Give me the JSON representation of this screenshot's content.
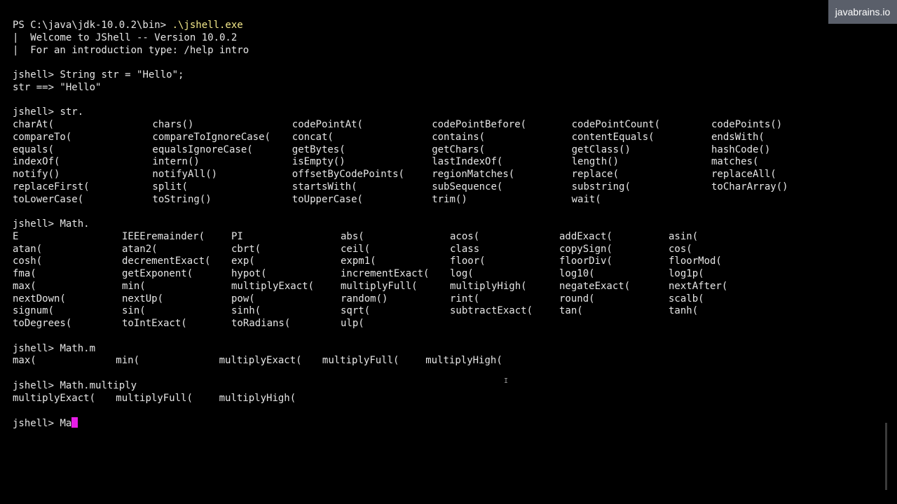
{
  "watermark": "javabrains.io",
  "session": {
    "ps_prompt": "PS C:\\java\\jdk-10.0.2\\bin> ",
    "ps_command": ".\\jshell.exe",
    "welcome_1": "|  Welcome to JShell -- Version 10.0.2",
    "welcome_2": "|  For an introduction type: /help intro",
    "prompt": "jshell> ",
    "cmd_string": "String str = \"Hello\";",
    "result_string": "str ==> \"Hello\"",
    "cmd_str_dot": "str.",
    "cmd_math_dot": "Math.",
    "cmd_math_m": "Math.m",
    "cmd_math_multiply": "Math.multiply",
    "cmd_current": "Ma"
  },
  "str_completions": [
    [
      "charAt(",
      "chars()",
      "codePointAt(",
      "codePointBefore(",
      "codePointCount(",
      "codePoints()"
    ],
    [
      "compareTo(",
      "compareToIgnoreCase(",
      "concat(",
      "contains(",
      "contentEquals(",
      "endsWith("
    ],
    [
      "equals(",
      "equalsIgnoreCase(",
      "getBytes(",
      "getChars(",
      "getClass()",
      "hashCode()"
    ],
    [
      "indexOf(",
      "intern()",
      "isEmpty()",
      "lastIndexOf(",
      "length()",
      "matches("
    ],
    [
      "notify()",
      "notifyAll()",
      "offsetByCodePoints(",
      "regionMatches(",
      "replace(",
      "replaceAll("
    ],
    [
      "replaceFirst(",
      "split(",
      "startsWith(",
      "subSequence(",
      "substring(",
      "toCharArray()"
    ],
    [
      "toLowerCase(",
      "toString()",
      "toUpperCase(",
      "trim()",
      "wait(",
      ""
    ]
  ],
  "math_completions": [
    [
      "E",
      "IEEEremainder(",
      "PI",
      "abs(",
      "acos(",
      "addExact(",
      "asin("
    ],
    [
      "atan(",
      "atan2(",
      "cbrt(",
      "ceil(",
      "class",
      "copySign(",
      "cos("
    ],
    [
      "cosh(",
      "decrementExact(",
      "exp(",
      "expm1(",
      "floor(",
      "floorDiv(",
      "floorMod("
    ],
    [
      "fma(",
      "getExponent(",
      "hypot(",
      "incrementExact(",
      "log(",
      "log10(",
      "log1p("
    ],
    [
      "max(",
      "min(",
      "multiplyExact(",
      "multiplyFull(",
      "multiplyHigh(",
      "negateExact(",
      "nextAfter("
    ],
    [
      "nextDown(",
      "nextUp(",
      "pow(",
      "random()",
      "rint(",
      "round(",
      "scalb("
    ],
    [
      "signum(",
      "sin(",
      "sinh(",
      "sqrt(",
      "subtractExact(",
      "tan(",
      "tanh("
    ],
    [
      "toDegrees(",
      "toIntExact(",
      "toRadians(",
      "ulp(",
      "",
      "",
      ""
    ]
  ],
  "math_m_completions": [
    "max(",
    "min(",
    "multiplyExact(",
    "multiplyFull(",
    "multiplyHigh("
  ],
  "math_multiply_completions": [
    "multiplyExact(",
    "multiplyFull(",
    "multiplyHigh("
  ],
  "colors": {
    "background": "#000000",
    "foreground": "#e6e6e6",
    "command_highlight": "#f4e98b",
    "cursor": "#e61ee6",
    "watermark_bg": "#5a5f6a"
  }
}
